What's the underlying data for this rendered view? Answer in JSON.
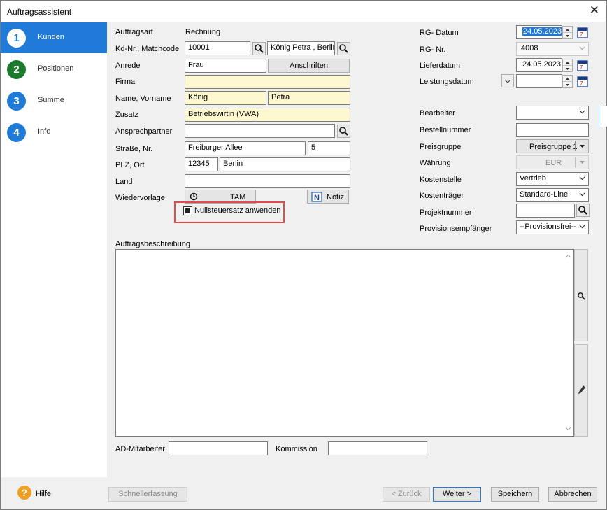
{
  "window": {
    "title": "Auftragsassistent",
    "close_glyph": "✕"
  },
  "steps": [
    {
      "num": "1",
      "label": "Kunden",
      "color": "#ffffff"
    },
    {
      "num": "2",
      "label": "Positionen",
      "color": "#1b7a2e"
    },
    {
      "num": "3",
      "label": "Summe",
      "color": "#1f7ad8"
    },
    {
      "num": "4",
      "label": "Info",
      "color": "#1f7ad8"
    }
  ],
  "form": {
    "auftragsart_label": "Auftragsart",
    "auftragsart_value": "Rechnung",
    "kdnr_label": "Kd-Nr.,  Matchcode",
    "kdnr_value": "10001",
    "matchcode_value": "König Petra , Berlin",
    "anrede_label": "Anrede",
    "anrede_value": "Frau",
    "anschriften_btn": "Anschriften",
    "firma_label": "Firma",
    "firma_value": "",
    "name_label": "Name,   Vorname",
    "name_value": "König",
    "vorname_value": "Petra",
    "zusatz_label": "Zusatz",
    "zusatz_value": "Betriebswirtin (VWA)",
    "ansprech_label": "Ansprechpartner",
    "ansprech_value": "",
    "strasse_label": "Straße,  Nr.",
    "strasse_value": "Freiburger Allee",
    "nr_value": "5",
    "plz_label": "PLZ,      Ort",
    "plz_value": "12345",
    "ort_value": "Berlin",
    "land_label": "Land",
    "land_value": "",
    "wiedervorlage_label": "Wiedervorlage",
    "tam_btn": "TAM",
    "notiz_btn": "Notiz",
    "nullsteuer_label": "Nullsteuersatz anwenden",
    "nullsteuer_checked": true
  },
  "right": {
    "rgdatum_label": "RG- Datum",
    "rgdatum_value": "24.05.2023",
    "rgnr_label": "RG- Nr.",
    "rgnr_value": "4008",
    "lieferdatum_label": "Lieferdatum",
    "lieferdatum_value": "24.05.2023",
    "leistungsdatum_label": "Leistungsdatum",
    "leistungsdatum_value": "",
    "bearbeiter_label": "Bearbeiter",
    "bearbeiter_value": "",
    "bestellnr_label": "Bestellnummer",
    "bestellnr_value": "",
    "preisgruppe_label": "Preisgruppe",
    "preisgruppe_value": "Preisgruppe 1",
    "waehrung_label": "Währung",
    "waehrung_value": "EUR",
    "kostenstelle_label": "Kostenstelle",
    "kostenstelle_value": "Vertrieb",
    "kostentraeger_label": "Kostenträger",
    "kostentraeger_value": "Standard-Line",
    "projektnr_label": "Projektnummer",
    "projektnr_value": "",
    "provision_label": "Provisionsempfänger",
    "provision_value": "--Provisionsfrei--"
  },
  "memo": {
    "label": "Auftragsbeschreibung",
    "value": ""
  },
  "bottom": {
    "ad_label": "AD-Mitarbeiter",
    "ad_value": "",
    "kommission_label": "Kommission",
    "kommission_value": ""
  },
  "footer": {
    "hilfe": "Hilfe",
    "schnellerfassung": "Schnellerfassung",
    "zurueck": "< Zurück",
    "weiter": "Weiter >",
    "speichern": "Speichern",
    "abbrechen": "Abbrechen"
  },
  "colors": {
    "accent": "#1f7ad8",
    "highlight": "#e04c4c",
    "required_field": "#fdf8cf",
    "help": "#f0a020"
  }
}
